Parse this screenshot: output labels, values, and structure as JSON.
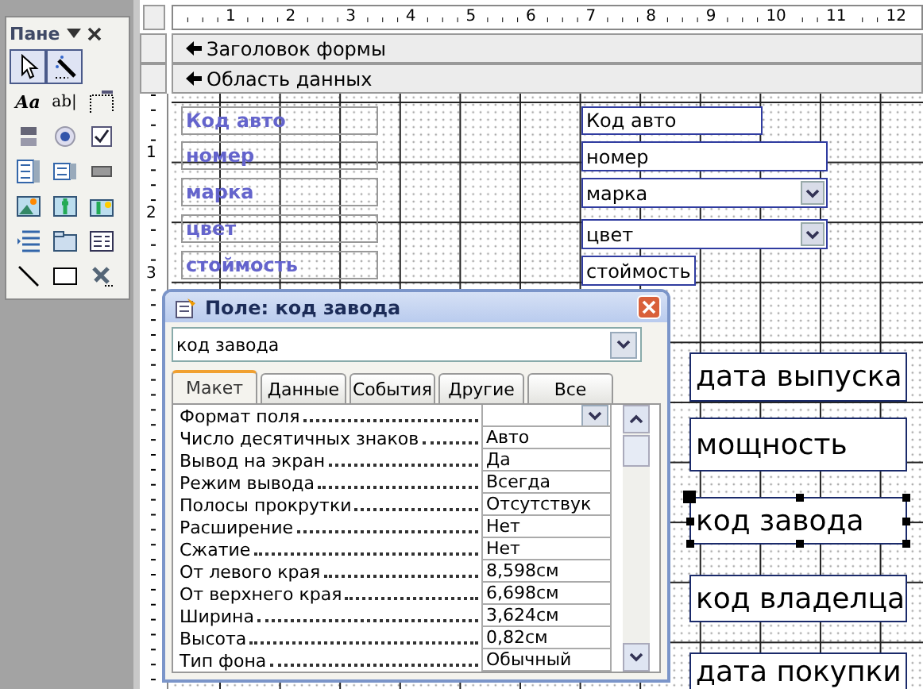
{
  "toolbox": {
    "title": "Пане",
    "tools": [
      {
        "kind": "pointer",
        "selected": true
      },
      {
        "kind": "wizard",
        "selected": true
      },
      {
        "kind": "text",
        "label": "Aa",
        "selected": false
      },
      {
        "kind": "text",
        "label": "ab|",
        "selected": false
      },
      {
        "kind": "field",
        "selected": false
      },
      {
        "kind": "toggle",
        "selected": false
      },
      {
        "kind": "radio",
        "selected": false
      },
      {
        "kind": "checkbox",
        "selected": false
      },
      {
        "kind": "combo",
        "selected": false
      },
      {
        "kind": "list",
        "selected": false
      },
      {
        "kind": "button",
        "selected": false
      },
      {
        "kind": "image",
        "selected": false
      },
      {
        "kind": "unbound",
        "selected": false
      },
      {
        "kind": "bound",
        "selected": false
      },
      {
        "kind": "pagebreak",
        "selected": false
      },
      {
        "kind": "tab",
        "selected": false
      },
      {
        "kind": "subform",
        "selected": false
      },
      {
        "kind": "line",
        "selected": false
      },
      {
        "kind": "rect",
        "selected": false
      },
      {
        "kind": "more",
        "selected": false
      }
    ]
  },
  "ruler": {
    "horizontal": [
      "1",
      "2",
      "3",
      "4",
      "5",
      "6",
      "7",
      "8",
      "9",
      "10",
      "11",
      "12"
    ],
    "vertical": [
      "1",
      "2",
      "3"
    ]
  },
  "sections": [
    "Заголовок формы",
    "Область данных"
  ],
  "controls": [
    {
      "kind": "label",
      "text": "Код авто",
      "selected": false
    },
    {
      "kind": "label",
      "text": "номер",
      "selected": false
    },
    {
      "kind": "label",
      "text": "марка",
      "selected": false
    },
    {
      "kind": "label",
      "text": "цвет",
      "selected": false
    },
    {
      "kind": "label",
      "text": "стоймость",
      "selected": false
    },
    {
      "kind": "textbox",
      "text": "Код авто",
      "selected": false
    },
    {
      "kind": "textbox",
      "text": "номер",
      "selected": false
    },
    {
      "kind": "combo",
      "text": "марка",
      "selected": false
    },
    {
      "kind": "combo",
      "text": "цвет",
      "selected": false
    },
    {
      "kind": "textbox",
      "text": "стоймость",
      "selected": false
    },
    {
      "kind": "bigbox",
      "text": "дата выпуска",
      "selected": false
    },
    {
      "kind": "bigbox",
      "text": "мощность",
      "selected": false
    },
    {
      "kind": "bigbox",
      "text": "код завода",
      "selected": true
    },
    {
      "kind": "bigbox",
      "text": "код владелца",
      "selected": false
    },
    {
      "kind": "bigbox",
      "text": "дата покупки",
      "selected": false
    }
  ],
  "property_sheet": {
    "title": "Поле: код завода",
    "object": "код завода",
    "tabs": [
      {
        "label": "Макет",
        "selected": true
      },
      {
        "label": "Данные",
        "selected": false
      },
      {
        "label": "События",
        "selected": false
      },
      {
        "label": "Другие",
        "selected": false
      },
      {
        "label": "Все",
        "selected": false
      }
    ],
    "properties": [
      {
        "name": "Формат поля",
        "kind": "dropdown"
      },
      {
        "name": "Число десятичных знаков",
        "value": "Авто",
        "kind": "text"
      },
      {
        "name": "Вывод на экран",
        "value": "Да",
        "kind": "text"
      },
      {
        "name": "Режим вывода",
        "value": "Всегда",
        "kind": "text"
      },
      {
        "name": "Полосы прокрутки",
        "value": "Отсутствук",
        "kind": "text"
      },
      {
        "name": "Расширение",
        "value": "Нет",
        "kind": "text"
      },
      {
        "name": "Сжатие",
        "value": "Нет",
        "kind": "text"
      },
      {
        "name": "От левого края",
        "value": "8,598см",
        "kind": "text"
      },
      {
        "name": "От верхнего края",
        "value": "6,698см",
        "kind": "text"
      },
      {
        "name": "Ширина",
        "value": "3,624см",
        "kind": "text"
      },
      {
        "name": "Высота",
        "value": "0,82см",
        "kind": "text"
      },
      {
        "name": "Тип фона",
        "value": "Обычный",
        "kind": "text"
      }
    ]
  }
}
